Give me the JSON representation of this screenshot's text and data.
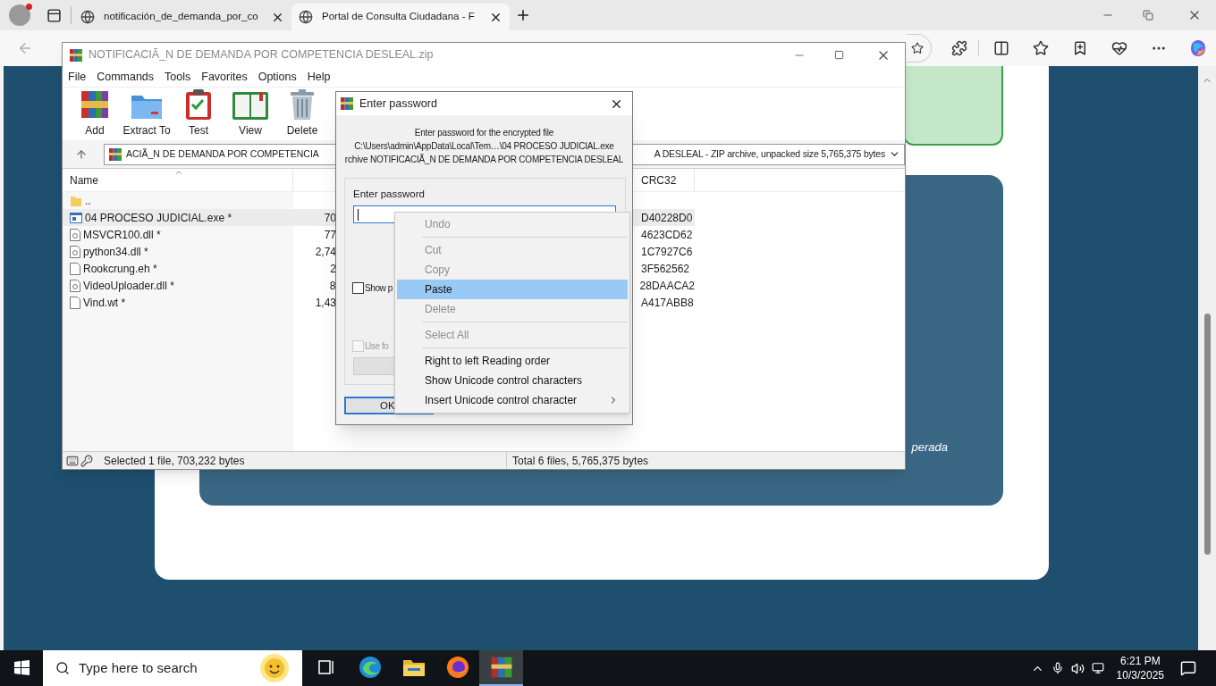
{
  "browser": {
    "tabs": [
      {
        "title": "notificación_de_demanda_por_co",
        "selected": false
      },
      {
        "title": "Portal de Consulta Ciudadana - F",
        "selected": true
      }
    ]
  },
  "page": {
    "card_text": "perada"
  },
  "winrar": {
    "title": "NOTIFICACIÃ_N DE DEMANDA POR COMPETENCIA DESLEAL.zip",
    "menu": [
      "File",
      "Commands",
      "Tools",
      "Favorites",
      "Options",
      "Help"
    ],
    "toolbar": [
      {
        "kind": "add",
        "label": "Add"
      },
      {
        "kind": "extract",
        "label": "Extract To"
      },
      {
        "kind": "test",
        "label": "Test"
      },
      {
        "kind": "view",
        "label": "View"
      },
      {
        "kind": "delete",
        "label": "Delete"
      }
    ],
    "address_left": "ACIÃ_N DE DEMANDA POR COMPETENCIA",
    "address_right": "A DESLEAL - ZIP archive, unpacked size 5,765,375 bytes",
    "columns": {
      "name": "Name",
      "crc": "CRC32"
    },
    "files": [
      {
        "kind": "folder",
        "name": "..",
        "selected": false
      },
      {
        "kind": "exe",
        "name": "04 PROCESO JUDICIAL.exe *",
        "size": "70",
        "crc": "D40228D0",
        "selected": true
      },
      {
        "kind": "dll",
        "name": "MSVCR100.dll *",
        "size": "77",
        "crc": "4623CD62",
        "selected": false
      },
      {
        "kind": "dll",
        "name": "python34.dll *",
        "size": "2,74",
        "crc": "1C7927C6",
        "selected": false
      },
      {
        "kind": "file",
        "name": "Rookcrung.eh *",
        "size": "2",
        "crc": "3F562562",
        "selected": false
      },
      {
        "kind": "dll",
        "name": "VideoUploader.dll *",
        "size": "8",
        "crc": "28DAACA2",
        "selected": false
      },
      {
        "kind": "file",
        "name": "Vind.wt *",
        "size": "1,43",
        "crc": "A417ABB8",
        "selected": false
      }
    ],
    "status_left": "Selected 1 file, 703,232 bytes",
    "status_right": "Total 6 files, 5,765,375 bytes"
  },
  "dialog": {
    "title": "Enter password",
    "lines": [
      "Enter password for the encrypted file",
      "C:\\Users\\admin\\AppData\\Local\\Tem…\\04 PROCESO JUDICIAL.exe",
      "rchive NOTIFICACIÃ_N DE DEMANDA POR COMPETENCIA DESLEAL"
    ],
    "group_label": "Enter password",
    "show_password": {
      "label": "Show p",
      "checked": false,
      "disabled": false
    },
    "use_for": {
      "label": "Use fo",
      "checked": false,
      "disabled": true
    },
    "ok": "OK"
  },
  "context_menu": [
    {
      "kind": "item",
      "label": "Undo",
      "disabled": true,
      "selected": false
    },
    {
      "kind": "separator"
    },
    {
      "kind": "item",
      "label": "Cut",
      "disabled": true,
      "selected": false
    },
    {
      "kind": "item",
      "label": "Copy",
      "disabled": true,
      "selected": false
    },
    {
      "kind": "item",
      "label": "Paste",
      "disabled": false,
      "selected": true
    },
    {
      "kind": "item",
      "label": "Delete",
      "disabled": true,
      "selected": false
    },
    {
      "kind": "separator"
    },
    {
      "kind": "item",
      "label": "Select All",
      "disabled": true,
      "selected": false
    },
    {
      "kind": "separator"
    },
    {
      "kind": "item",
      "label": "Right to left Reading order",
      "disabled": false,
      "selected": false
    },
    {
      "kind": "item",
      "label": "Show Unicode control characters",
      "disabled": false,
      "selected": false
    },
    {
      "kind": "submenu",
      "label": "Insert Unicode control character",
      "disabled": false,
      "selected": false
    }
  ],
  "taskbar": {
    "search_placeholder": "Type here to search",
    "apps": [
      {
        "kind": "taskview",
        "active": false
      },
      {
        "kind": "edge",
        "active": false
      },
      {
        "kind": "explorer",
        "active": false
      },
      {
        "kind": "firefox",
        "active": false
      },
      {
        "kind": "winrar",
        "active": true
      }
    ],
    "time": "6:21 PM",
    "date": "10/3/2025"
  }
}
